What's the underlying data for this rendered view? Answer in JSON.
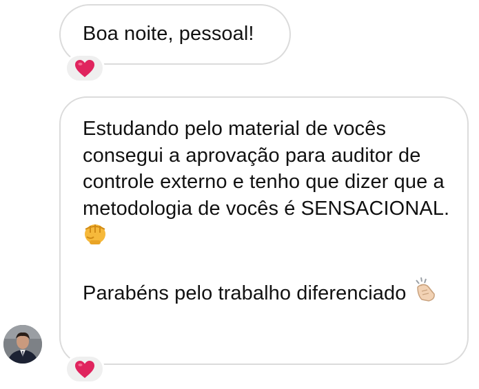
{
  "messages": [
    {
      "text": "Boa noite, pessoal!",
      "reaction": "heart-icon"
    },
    {
      "paragraphs": [
        "Estudando pelo material de vocês consegui a aprovação para auditor de controle externo e tenho que dizer que a metodologia de vocês é SENSACIONAL.",
        "Parabéns pelo trabalho diferenciado"
      ],
      "emojis": [
        "fist-icon",
        "clapping-hands-icon"
      ],
      "reaction": "heart-icon"
    }
  ],
  "colors": {
    "bubble_border": "#dbdbdb",
    "reaction_bg": "#efefef",
    "heart": "#e0245e",
    "text": "#111111"
  }
}
